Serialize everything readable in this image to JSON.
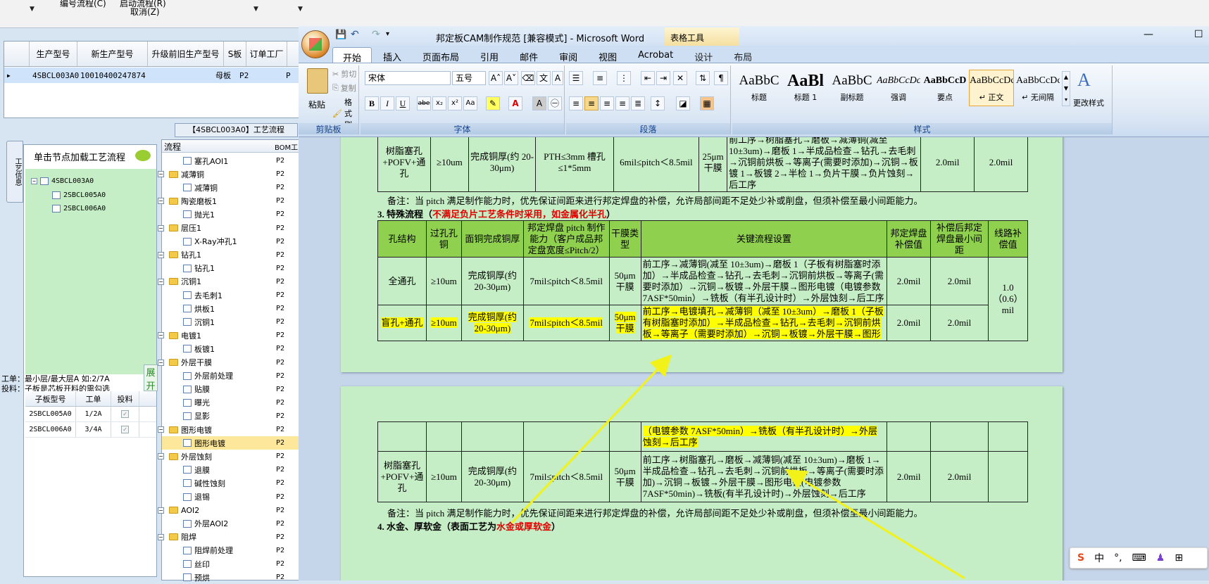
{
  "bg_app": {
    "top_labels": [
      "编号流程(C)",
      "启动流程(R)",
      "取消(Z)"
    ],
    "grid_headers": [
      "生产型号",
      "新生产型号",
      "升级前旧生产型号",
      "S板",
      "订单工厂"
    ],
    "grid_row": [
      "4SBCL003A0",
      "10010400247874",
      "母板",
      "P2",
      "P"
    ],
    "flow_tab": "【4SBCL003A0】工艺流程",
    "vertical_tab": "工艺信息",
    "tree_header": "单击节点加载工艺流程",
    "tree_nodes": [
      "4SBCL003A0",
      "2SBCL005A0",
      "2SBCL006A0"
    ],
    "info_line1": "工单：最小层/最大层A  如:2/7A",
    "info_line2": "投料：子板是芯板开料的需勾选",
    "expand_label": "展开",
    "sub_headers": [
      "子板型号",
      "工单",
      "投料"
    ],
    "sub_rows": [
      {
        "model": "2SBCL005A0",
        "order": "1/2A"
      },
      {
        "model": "2SBCL006A0",
        "order": "3/4A"
      }
    ],
    "flow_headers": [
      "流程",
      "BOM工"
    ],
    "flow_rows": [
      {
        "label": "塞孔AOI1",
        "level": 2,
        "p": "P2"
      },
      {
        "label": "减薄铜",
        "level": 1,
        "p": "P2"
      },
      {
        "label": "减薄铜",
        "level": 2,
        "p": "P2"
      },
      {
        "label": "陶瓷磨板1",
        "level": 1,
        "p": "P2"
      },
      {
        "label": "抛光1",
        "level": 2,
        "p": "P2"
      },
      {
        "label": "层压1",
        "level": 1,
        "p": "P2"
      },
      {
        "label": "X-Ray冲孔1",
        "level": 2,
        "p": "P2"
      },
      {
        "label": "钻孔1",
        "level": 1,
        "p": "P2"
      },
      {
        "label": "钻孔1",
        "level": 2,
        "p": "P2"
      },
      {
        "label": "沉铜1",
        "level": 1,
        "p": "P2"
      },
      {
        "label": "去毛刺1",
        "level": 2,
        "p": "P2"
      },
      {
        "label": "烘板1",
        "level": 2,
        "p": "P2"
      },
      {
        "label": "沉铜1",
        "level": 2,
        "p": "P2"
      },
      {
        "label": "电镀1",
        "level": 1,
        "p": "P2"
      },
      {
        "label": "板镀1",
        "level": 2,
        "p": "P2"
      },
      {
        "label": "外层干膜",
        "level": 1,
        "p": "P2"
      },
      {
        "label": "外层前处理",
        "level": 2,
        "p": "P2"
      },
      {
        "label": "贴膜",
        "level": 2,
        "p": "P2"
      },
      {
        "label": "曝光",
        "level": 2,
        "p": "P2"
      },
      {
        "label": "显影",
        "level": 2,
        "p": "P2"
      },
      {
        "label": "图形电镀",
        "level": 1,
        "p": "P2"
      },
      {
        "label": "图形电镀",
        "level": 2,
        "p": "P2",
        "selected": true
      },
      {
        "label": "外层蚀刻",
        "level": 1,
        "p": "P2"
      },
      {
        "label": "退膜",
        "level": 2,
        "p": "P2"
      },
      {
        "label": "碱性蚀刻",
        "level": 2,
        "p": "P2"
      },
      {
        "label": "退锡",
        "level": 2,
        "p": "P2"
      },
      {
        "label": "AOI2",
        "level": 1,
        "p": "P2"
      },
      {
        "label": "外层AOI2",
        "level": 2,
        "p": "P2"
      },
      {
        "label": "阻焊",
        "level": 1,
        "p": "P2"
      },
      {
        "label": "阻焊前处理",
        "level": 2,
        "p": "P2"
      },
      {
        "label": "丝印",
        "level": 2,
        "p": "P2"
      },
      {
        "label": "预烘",
        "level": 2,
        "p": "P2"
      }
    ]
  },
  "word": {
    "title": "邦定板CAM制作规范 [兼容模式] - Microsoft Word",
    "table_tools": "表格工具",
    "tabs": [
      "开始",
      "插入",
      "页面布局",
      "引用",
      "邮件",
      "审阅",
      "视图",
      "Acrobat",
      "设计",
      "布局"
    ],
    "clipboard": {
      "paste": "粘贴",
      "cut": "剪切",
      "copy": "复制",
      "format_painter": "格式刷",
      "label": "剪贴板"
    },
    "font": {
      "name": "宋体",
      "size": "五号",
      "label": "字体"
    },
    "paragraph_label": "段落",
    "styles": [
      {
        "preview": "AaBbC",
        "name": "标题"
      },
      {
        "preview": "AaBl",
        "name": "标题 1"
      },
      {
        "preview": "AaBbC",
        "name": "副标题"
      },
      {
        "preview": "AaBbCcDc",
        "name": "强调"
      },
      {
        "preview": "AaBbCcD",
        "name": "要点"
      },
      {
        "preview": "AaBbCcDc",
        "name": "↵ 正文"
      },
      {
        "preview": "AaBbCcDc",
        "name": "↵ 无间隔"
      }
    ],
    "styles_label": "样式",
    "change_styles": "更改样式"
  },
  "doc": {
    "top_row": {
      "c1": "树脂塞孔+POFV+通孔",
      "c2": "≥10um",
      "c3": "完成铜厚(约 20-30μm)",
      "c4": "PTH≤3mm 槽孔≤1*5mm",
      "c5": "6mil≤pitch＜8.5mil",
      "c6": "25μm干膜",
      "c7": "前工序→树脂塞孔→磨板→减薄铜(减至10±3um)→磨板 1→半成品检查→钻孔→去毛刺→沉铜前烘板→等离子(需要时添加)→沉铜→板镀 1→板镀 2→半检 1→负片干膜→负片蚀刻→后工序",
      "c8": "2.0mil",
      "c9": "2.0mil"
    },
    "note1": "备注：当 pitch 满足制作能力时，优先保证间距来进行邦定焊盘的补偿，允许局部间距不足处少补或削盘，但须补偿至最小间距能力。",
    "section3_prefix": "3. 特殊流程（",
    "section3_red": "不满足负片工艺条件时采用，如金属化半孔",
    "section3_suffix": "）",
    "headers": [
      "孔结构",
      "过孔孔铜",
      "面铜完成铜厚",
      "邦定焊盘 pitch 制作能力（客户成品邦定盘宽度≤Pitch/2）",
      "干膜类型",
      "关键流程设置",
      "邦定焊盘补偿值",
      "补偿后邦定焊盘最小间距",
      "线路补偿值"
    ],
    "row1": {
      "c1": "全通孔",
      "c2": "≥10um",
      "c3": "完成铜厚(约 20-30μm)",
      "c4": "7mil≤pitch＜8.5mil",
      "c5": "50μm干膜",
      "c6": "前工序→减薄铜(减至 10±3um)→磨板 1（子板有树脂塞时添加）→半成品检查→钻孔→去毛刺→沉铜前烘板→等离子(需要时添加）→沉铜→板镀→外层干膜→图形电镀（电镀参数 7ASF*50min）→铣板（有半孔设计时）→外层蚀刻→后工序",
      "c7": "2.0mil",
      "c8": "2.0mil",
      "c9": "1.0（0.6）mil"
    },
    "row2": {
      "c1": "盲孔+通孔",
      "c2": "≥10um",
      "c3": "完成铜厚(约 20-30μm)",
      "c4": "7mil≤pitch＜8.5mil",
      "c5": "50μm干膜",
      "c6": "前工序→电镀填孔→减薄铜（减至 10±3um）→磨板 1（子板有树脂塞时添加）→半成品检查→钻孔→去毛刺→沉铜前烘板→等离子（需要时添加）→沉铜→板镀→外层干膜→图形电镀",
      "c7": "2.0mil",
      "c8": "2.0mil"
    },
    "page2_cont": "（电镀参数 7ASF*50min）→铣板（有半孔设计时）→外层蚀刻→后工序",
    "row3": {
      "c1": "树脂塞孔+POFV+通孔",
      "c2": "≥10um",
      "c3": "完成铜厚(约 20-30μm)",
      "c4": "7mil≤pitch＜8.5mil",
      "c5": "50μm干膜",
      "c6": "前工序→树脂塞孔→磨板→减薄铜(减至 10±3um)→磨板 1→半成品检查→钻孔→去毛刺→沉铜前烘板→等离子(需要时添加)→沉铜→板镀→外层干膜→图形电镀(电镀参数 7ASF*50min)→铣板(有半孔设计时)→外层蚀刻→后工序",
      "c7": "2.0mil",
      "c8": "2.0mil"
    },
    "note2": "备注：当 pitch 满足制作能力时，优先保证间距来进行邦定焊盘的补偿，允许局部间距不足处少补或削盘，但须补偿至最小间距能力。",
    "section4_prefix": "4. 水金、厚软金（表面工艺为",
    "section4_red": "水金或厚软金",
    "section4_suffix": "）"
  },
  "ime": {
    "logo": "S",
    "lang": "中"
  },
  "colors": {
    "table_header": "#8fd14f",
    "highlight": "#ffff00",
    "page_bg": "#c6eec6",
    "arrow": "#f2f21a"
  }
}
